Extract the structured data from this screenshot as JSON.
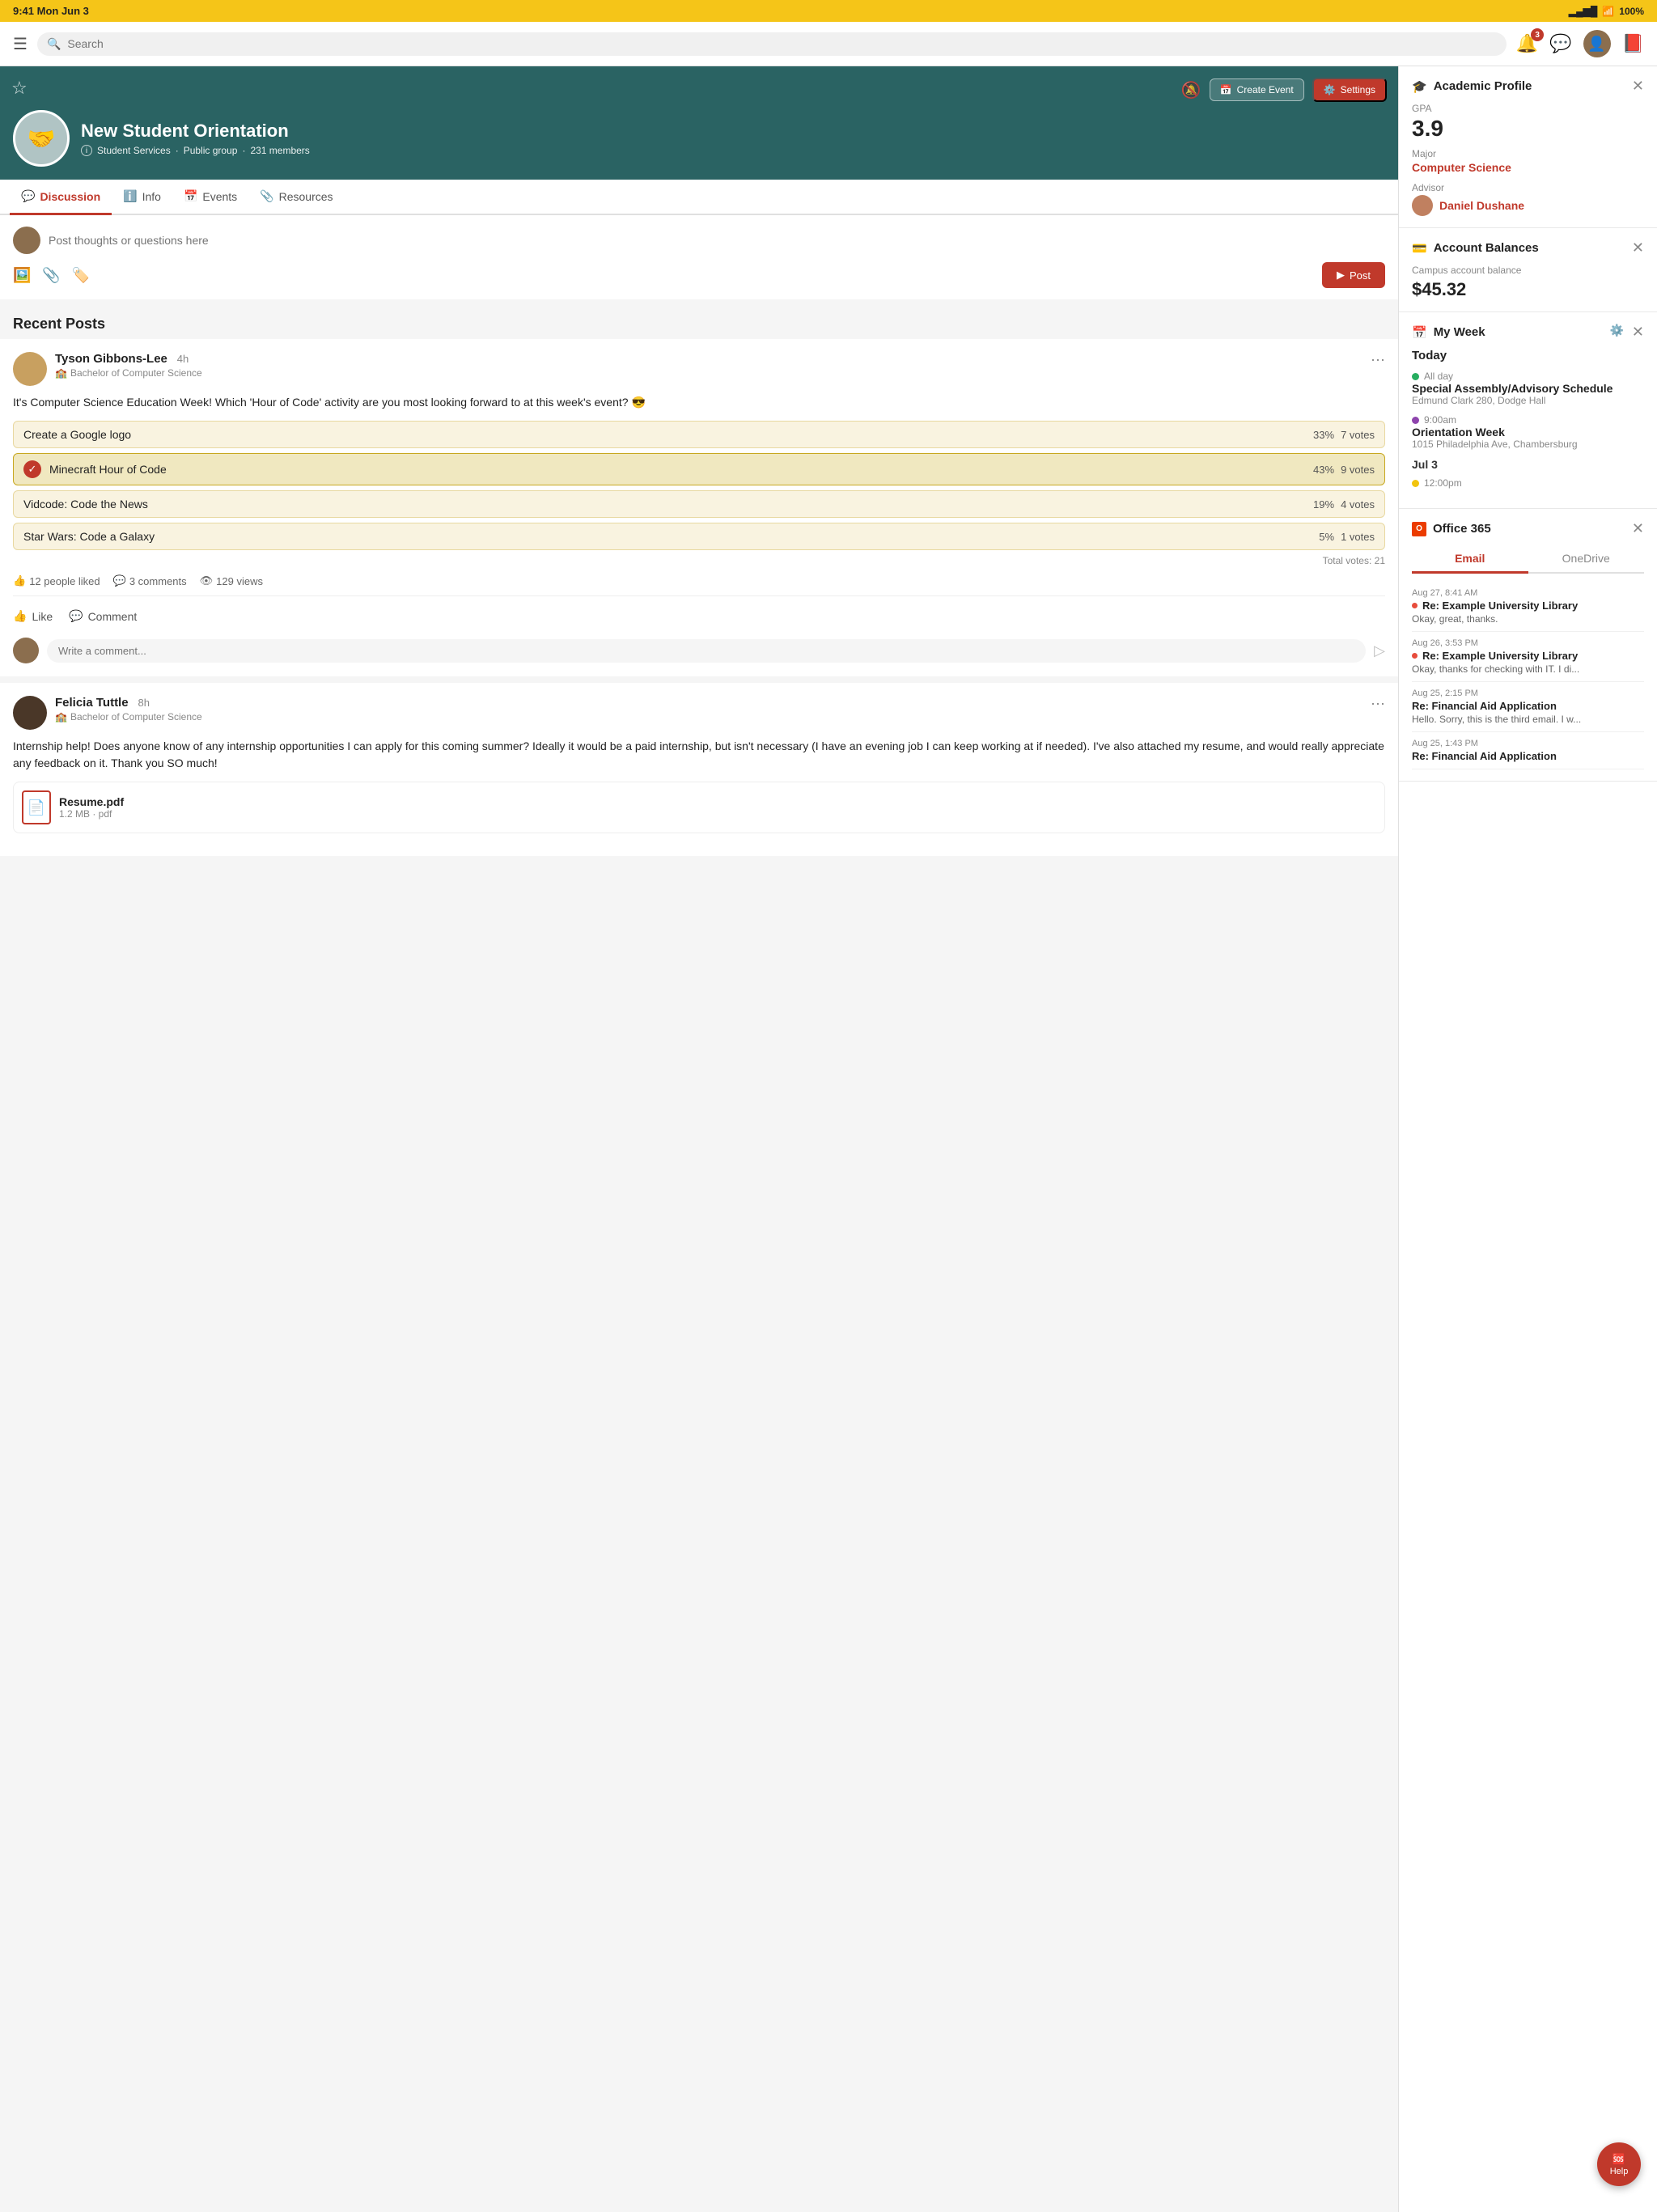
{
  "statusBar": {
    "time": "9:41 Mon Jun 3",
    "signal": "▂▄▆█",
    "wifi": "WiFi",
    "battery": "100%"
  },
  "topNav": {
    "searchPlaceholder": "Search",
    "notificationCount": "3"
  },
  "groupHeader": {
    "title": "New Student Orientation",
    "department": "Student Services",
    "type": "Public group",
    "members": "231 members",
    "createEventLabel": "Create Event",
    "settingsLabel": "Settings"
  },
  "tabs": [
    {
      "id": "discussion",
      "label": "Discussion",
      "active": true
    },
    {
      "id": "info",
      "label": "Info",
      "active": false
    },
    {
      "id": "events",
      "label": "Events",
      "active": false
    },
    {
      "id": "resources",
      "label": "Resources",
      "active": false
    }
  ],
  "postBox": {
    "placeholder": "Post thoughts or questions here",
    "postLabel": "Post"
  },
  "recentPostsHeader": "Recent Posts",
  "posts": [
    {
      "id": 1,
      "author": "Tyson Gibbons-Lee",
      "time": "4h",
      "badge": "Bachelor of Computer Science",
      "content": "It's Computer Science Education Week! Which 'Hour of Code' activity are you most looking forward to at this week's event? 😎",
      "hasPoll": true,
      "poll": {
        "options": [
          {
            "label": "Create a Google logo",
            "pct": "33%",
            "votes": "7 votes",
            "selected": false
          },
          {
            "label": "Minecraft Hour of Code",
            "pct": "43%",
            "votes": "9 votes",
            "selected": true
          },
          {
            "label": "Vidcode: Code the News",
            "pct": "19%",
            "votes": "4 votes",
            "selected": false
          },
          {
            "label": "Star Wars: Code a Galaxy",
            "pct": "5%",
            "votes": "1 votes",
            "selected": false
          }
        ],
        "totalVotes": "Total votes: 21"
      },
      "likes": "12 people liked",
      "comments": "3 comments",
      "views": "129 views",
      "likeLabel": "Like",
      "commentLabel": "Comment",
      "commentPlaceholder": "Write a comment..."
    },
    {
      "id": 2,
      "author": "Felicia Tuttle",
      "time": "8h",
      "badge": "Bachelor of Computer Science",
      "content": "Internship help! Does anyone know of any internship opportunities I can apply for this coming summer? Ideally it would be a paid internship, but isn't necessary (I have an evening job I can keep working at if needed). I've also attached my resume, and would really appreciate any feedback on it. Thank you SO much!",
      "hasPoll": false,
      "hasAttachment": true,
      "attachment": {
        "name": "Resume.pdf",
        "size": "1.2 MB",
        "type": "pdf"
      }
    }
  ],
  "rightPanel": {
    "academicProfile": {
      "title": "Academic Profile",
      "gpaLabel": "GPA",
      "gpaValue": "3.9",
      "majorLabel": "Major",
      "majorValue": "Computer Science",
      "advisorLabel": "Advisor",
      "advisorValue": "Daniel Dushane"
    },
    "accountBalances": {
      "title": "Account Balances",
      "balanceLabel": "Campus account balance",
      "balanceValue": "$45.32"
    },
    "myWeek": {
      "title": "My Week",
      "todayLabel": "Today",
      "events": [
        {
          "time": "All day",
          "dot": "green",
          "name": "Special Assembly/Advisory Schedule",
          "location": "Edmund Clark 280, Dodge Hall"
        },
        {
          "time": "9:00am",
          "dot": "purple",
          "name": "Orientation Week",
          "location": "1015 Philadelphia Ave, Chambersburg"
        }
      ],
      "jul3Label": "Jul 3",
      "jul3Events": [
        {
          "time": "12:00pm",
          "dot": "yellow",
          "name": "",
          "location": ""
        }
      ]
    },
    "office365": {
      "title": "Office 365",
      "tabs": [
        "Email",
        "OneDrive"
      ],
      "activeTab": "Email",
      "emails": [
        {
          "date": "Aug 27, 8:41 AM",
          "subject": "Re: Example University Library",
          "preview": "Okay, great, thanks.",
          "unread": true
        },
        {
          "date": "Aug 26, 3:53 PM",
          "subject": "Re: Example University Library",
          "preview": "Okay, thanks for checking with IT. I di...",
          "unread": true
        },
        {
          "date": "Aug 25, 2:15 PM",
          "subject": "Re: Financial Aid Application",
          "preview": "Hello. Sorry, this is the third email. I w...",
          "unread": false
        },
        {
          "date": "Aug 25, 1:43 PM",
          "subject": "Re: Financial Aid Application",
          "preview": "",
          "unread": false
        }
      ]
    }
  },
  "helpButton": "Help"
}
